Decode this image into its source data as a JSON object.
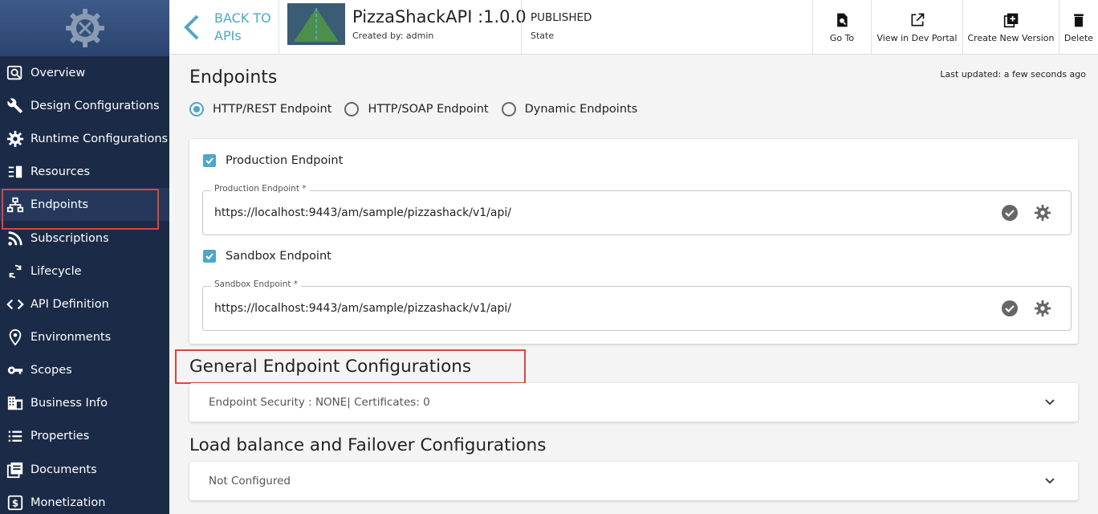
{
  "sidebar": {
    "items": [
      {
        "label": "Overview",
        "icon": "overview-icon"
      },
      {
        "label": "Design Configurations",
        "icon": "wrench-icon"
      },
      {
        "label": "Runtime Configurations",
        "icon": "gear-icon"
      },
      {
        "label": "Resources",
        "icon": "resources-icon"
      },
      {
        "label": "Endpoints",
        "icon": "endpoints-icon",
        "active": true
      },
      {
        "label": "Subscriptions",
        "icon": "rss-icon"
      },
      {
        "label": "Lifecycle",
        "icon": "cycle-icon"
      },
      {
        "label": "API Definition",
        "icon": "code-icon"
      },
      {
        "label": "Environments",
        "icon": "location-icon"
      },
      {
        "label": "Scopes",
        "icon": "key-icon"
      },
      {
        "label": "Business Info",
        "icon": "building-icon"
      },
      {
        "label": "Properties",
        "icon": "list-icon"
      },
      {
        "label": "Documents",
        "icon": "documents-icon"
      },
      {
        "label": "Monetization",
        "icon": "dollar-icon"
      }
    ]
  },
  "header": {
    "back_label": "BACK TO APIs",
    "api_name": "PizzaShackAPI :1.0.0",
    "created_by": "Created by: admin",
    "state_value": "PUBLISHED",
    "state_label": "State",
    "actions": {
      "goto": "Go To",
      "dev_portal": "View in Dev Portal",
      "new_version": "Create New Version",
      "delete": "Delete"
    }
  },
  "main": {
    "title": "Endpoints",
    "last_updated": "Last updated: a few seconds ago",
    "endpoint_types": [
      "HTTP/REST Endpoint",
      "HTTP/SOAP Endpoint",
      "Dynamic Endpoints"
    ],
    "selected_type": "HTTP/REST Endpoint",
    "production": {
      "checkbox_label": "Production Endpoint",
      "field_label": "Production Endpoint *",
      "value": "https://localhost:9443/am/sample/pizzashack/v1/api/"
    },
    "sandbox": {
      "checkbox_label": "Sandbox Endpoint",
      "field_label": "Sandbox Endpoint *",
      "value": "https://localhost:9443/am/sample/pizzashack/v1/api/"
    },
    "general_title": "General Endpoint Configurations",
    "general_summary": "Endpoint Security : NONE| Certificates: 0",
    "lb_title": "Load balance and Failover Configurations",
    "lb_summary": "Not Configured"
  },
  "colors": {
    "sidebar_bg": "#1b2a47",
    "accent": "#4fa6c9",
    "highlight": "#d9463b"
  }
}
